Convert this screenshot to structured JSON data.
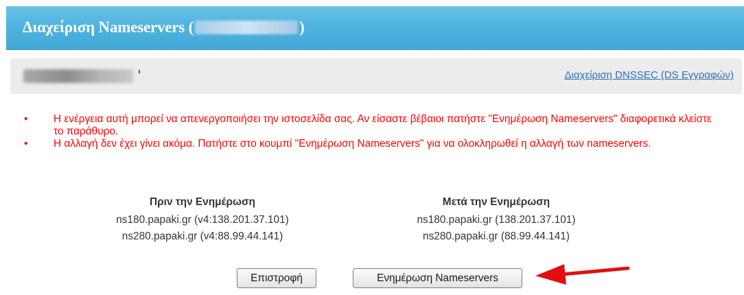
{
  "dialog": {
    "title_prefix": "Διαχείριση Nameservers (",
    "title_suffix": ")"
  },
  "domain_bar": {
    "dnssec_link": "Διαχείριση DNSSEC (DS Εγγραφών)"
  },
  "warnings": [
    "Η ενέργεια αυτή μπορεί να απενεργοποιήσει την ιστοσελίδα σας. Αν είσαστε βέβαιοι πατήστε \"Ενημέρωση Nameservers\" διαφορετικά κλείστε το παράθυρο.",
    "Η αλλαγή δεν έχει γίνει ακόμα. Πατήστε στο κουμπί \"Ενημέρωση Nameservers\" για να ολοκληρωθεί η αλλαγή των nameservers."
  ],
  "before": {
    "heading": "Πριν την Ενημέρωση",
    "lines": [
      "ns180.papaki.gr (v4:138.201.37.101)",
      "ns280.papaki.gr (v4:88.99.44.141)"
    ]
  },
  "after": {
    "heading": "Μετά την Ενημέρωση",
    "lines": [
      "ns180.papaki.gr (138.201.37.101)",
      "ns280.papaki.gr (88.99.44.141)"
    ]
  },
  "buttons": {
    "back_label": "Επιστροφή",
    "update_label": "Ενημέρωση Nameservers"
  },
  "colors": {
    "header": "#4fb3df",
    "warning": "#ff0000",
    "link": "#2a6fb3",
    "arrow": "#e01010"
  },
  "icons": {
    "annotation": "red-arrow-icon"
  }
}
